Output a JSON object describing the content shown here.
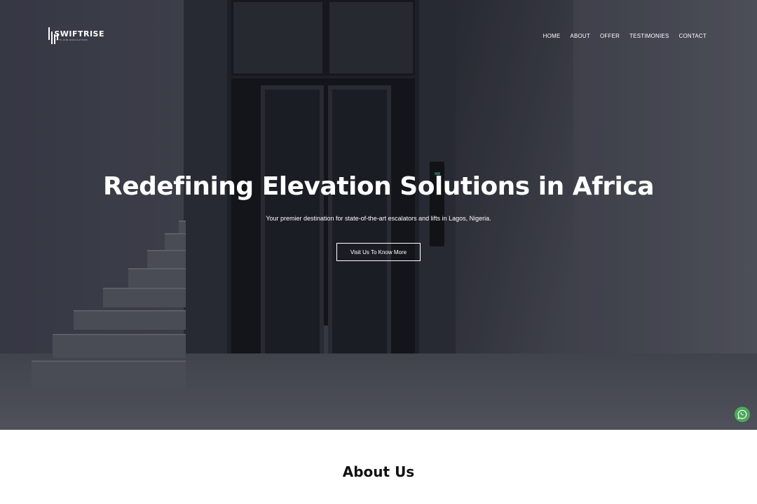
{
  "brand": {
    "name": "SWIFTRISE",
    "tagline": "LIFTS AND ESCALATORS",
    "logo_icon": "bars-logo-icon"
  },
  "nav": {
    "items": [
      "HOME",
      "ABOUT",
      "OFFER",
      "TESTIMONIES",
      "CONTACT"
    ]
  },
  "hero": {
    "title": "Redefining Elevation Solutions in Africa",
    "subtitle": "Your premier destination for state-of-the-art escalators and lifts in Lagos, Nigeria.",
    "cta_label": "Visit Us To Know More",
    "background_image": "elevator-staircase-photo"
  },
  "floating": {
    "whatsapp_icon": "whatsapp-icon",
    "whatsapp_color": "#4caa5b"
  },
  "about": {
    "title": "About Us"
  },
  "colors": {
    "hero_overlay": "#2a2b38",
    "text_light": "#ffffff",
    "text_dark": "#111111"
  }
}
